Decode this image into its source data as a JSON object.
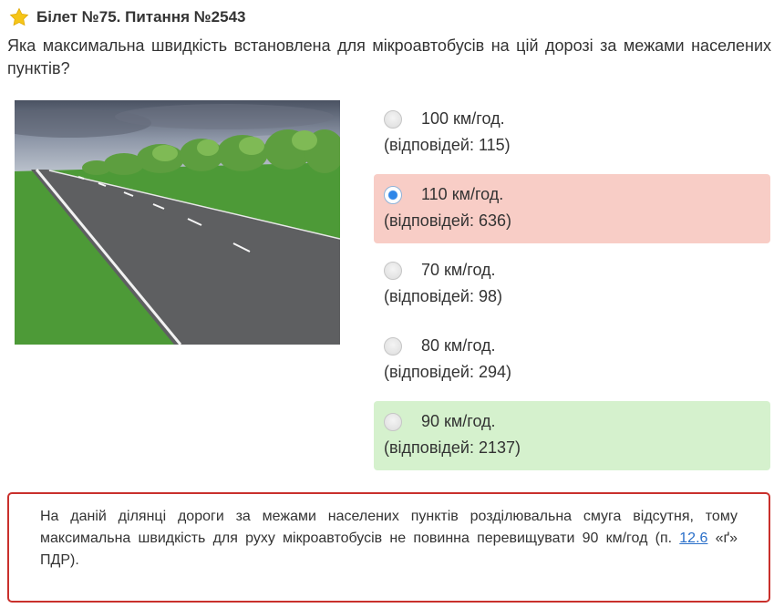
{
  "header": {
    "title": "Білет №75. Питання №2543",
    "star_color": "#f5c518"
  },
  "question": {
    "text": "Яка максимальна швидкість встановлена для мікроавтобусів на цій дорозі за межами населених пунктів?"
  },
  "answers": [
    {
      "label": "100 км/год.",
      "count": "(відповідей: 115)",
      "state": "none",
      "selected": false
    },
    {
      "label": "110 км/год.",
      "count": "(відповідей: 636)",
      "state": "wrong",
      "selected": true
    },
    {
      "label": "70 км/год.",
      "count": "(відповідей: 98)",
      "state": "none",
      "selected": false
    },
    {
      "label": "80 км/год.",
      "count": "(відповідей: 294)",
      "state": "none",
      "selected": false
    },
    {
      "label": "90 км/год.",
      "count": "(відповідей: 2137)",
      "state": "correct",
      "selected": false
    }
  ],
  "explanation": {
    "text_before": "На даній ділянці дороги за межами населених пунктів розділювальна смуга відсутня, тому максимальна швидкість для руху мікроавтобусів не повинна перевищувати 90 км/год (п. ",
    "link_text": "12.6",
    "text_after": " «ґ» ПДР)."
  },
  "colors": {
    "wrong_bg": "#f8cdc6",
    "correct_bg": "#d5f1cd",
    "explanation_border": "#c9302c",
    "link": "#2a6fc9"
  }
}
